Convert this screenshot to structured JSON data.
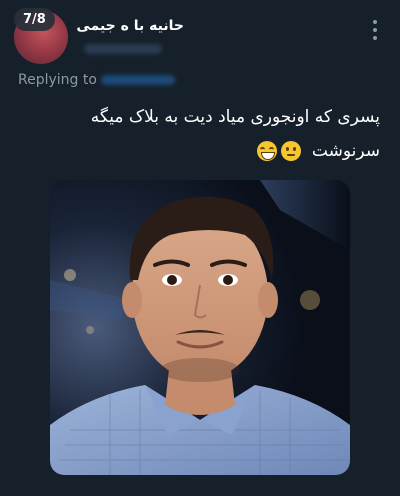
{
  "tweet": {
    "counter": "7/8",
    "display_name": "حانیه با ه جیمی",
    "replying_prefix": "Replying to",
    "text_line1": "پسری که اونجوری میاد دیت به بلاک میگه",
    "text_line2": "سرنوشت",
    "emojis": [
      "slightly-frowning-face",
      "grinning-squinting-face"
    ]
  },
  "colors": {
    "background": "#15202b",
    "secondary_text": "#8b98a5",
    "mention_link": "#1d9bf0"
  },
  "icons": {
    "more": "vertical-ellipsis-icon"
  }
}
